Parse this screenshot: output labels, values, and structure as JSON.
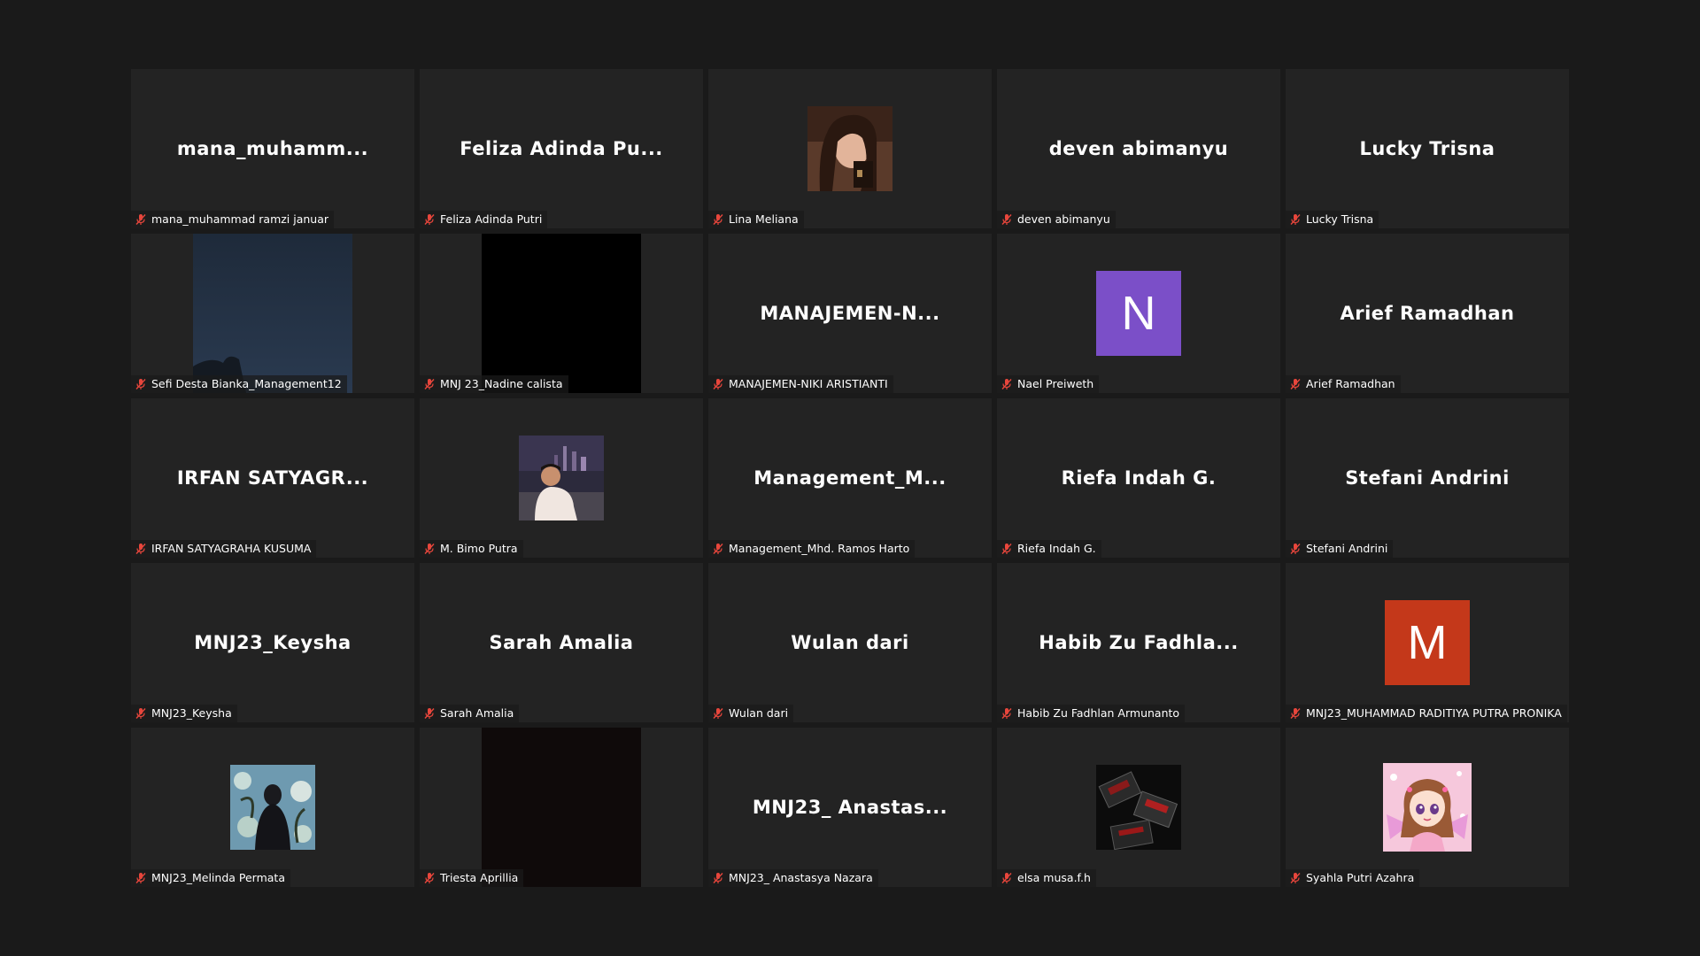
{
  "colors": {
    "background": "#1a1a1a",
    "tile": "#232323",
    "muted_mic": "#e8463c",
    "avatar_n": "#7b4fc8",
    "avatar_m": "#c4381a"
  },
  "tiles": [
    {
      "display": "mana_muhamm...",
      "name": "mana_muhammad ramzi januar"
    },
    {
      "display": "Feliza  Adinda  Pu...",
      "name": "Feliza Adinda Putri"
    },
    {
      "display": "",
      "name": "Lina Meliana"
    },
    {
      "display": "deven  abimanyu",
      "name": "deven abimanyu"
    },
    {
      "display": "Lucky  Trisna",
      "name": "Lucky Trisna"
    },
    {
      "display": "",
      "name": "Sefi Desta Bianka_Management12"
    },
    {
      "display": "",
      "name": "MNJ 23_Nadine calista"
    },
    {
      "display": "MANAJEMEN-N...",
      "name": "MANAJEMEN-NIKI ARISTIANTI"
    },
    {
      "display": "",
      "name": "Nael Preiweth",
      "letter": "N"
    },
    {
      "display": "Arief  Ramadhan",
      "name": "Arief Ramadhan"
    },
    {
      "display": "IRFAN  SATYAGR...",
      "name": "IRFAN SATYAGRAHA KUSUMA"
    },
    {
      "display": "",
      "name": "M. Bimo Putra"
    },
    {
      "display": "Management_M...",
      "name": "Management_Mhd. Ramos Harto"
    },
    {
      "display": "Riefa  Indah  G.",
      "name": "Riefa Indah G."
    },
    {
      "display": "Stefani  Andrini",
      "name": "Stefani Andrini"
    },
    {
      "display": "MNJ23_Keysha",
      "name": "MNJ23_Keysha"
    },
    {
      "display": "Sarah  Amalia",
      "name": "Sarah Amalia"
    },
    {
      "display": "Wulan  dari",
      "name": "Wulan dari"
    },
    {
      "display": "Habib  Zu  Fadhla...",
      "name": "Habib Zu Fadhlan Armunanto"
    },
    {
      "display": "",
      "name": "MNJ23_MUHAMMAD RADITIYA PUTRA PRONIKA",
      "letter": "M"
    },
    {
      "display": "",
      "name": "MNJ23_Melinda Permata"
    },
    {
      "display": "",
      "name": "Triesta Aprillia"
    },
    {
      "display": "MNJ23_  Anastas...",
      "name": "MNJ23_ Anastasya Nazara"
    },
    {
      "display": "",
      "name": "elsa musa.f.h"
    },
    {
      "display": "",
      "name": "Syahla Putri Azahra"
    }
  ]
}
